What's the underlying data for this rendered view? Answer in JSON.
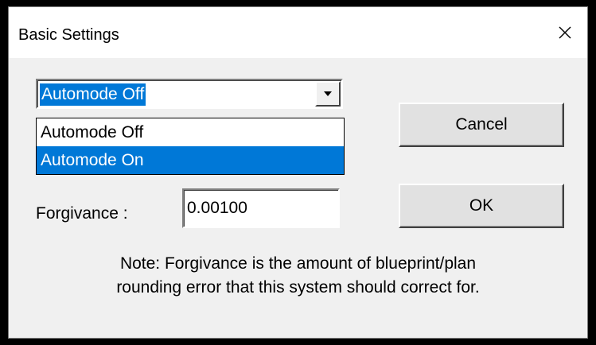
{
  "window": {
    "title": "Basic Settings",
    "close_glyph": "×"
  },
  "mode_select": {
    "selected": "Automode Off",
    "options": [
      "Automode Off",
      "Automode On"
    ],
    "highlighted_option": "Automode On"
  },
  "forgivance": {
    "label": "Forgivance :",
    "value": "0.00100"
  },
  "buttons": {
    "cancel_label": "Cancel",
    "ok_label": "OK"
  },
  "note": {
    "line1": "Note: Forgivance is the amount of blueprint/plan",
    "line2": "rounding error that this system should correct for."
  },
  "icons": {
    "close": "close-icon",
    "dropdown": "chevron-down-icon"
  },
  "colors": {
    "selection": "#0078d7",
    "dialog_bg": "#f0f0f0",
    "titlebar_bg": "#ffffff"
  }
}
